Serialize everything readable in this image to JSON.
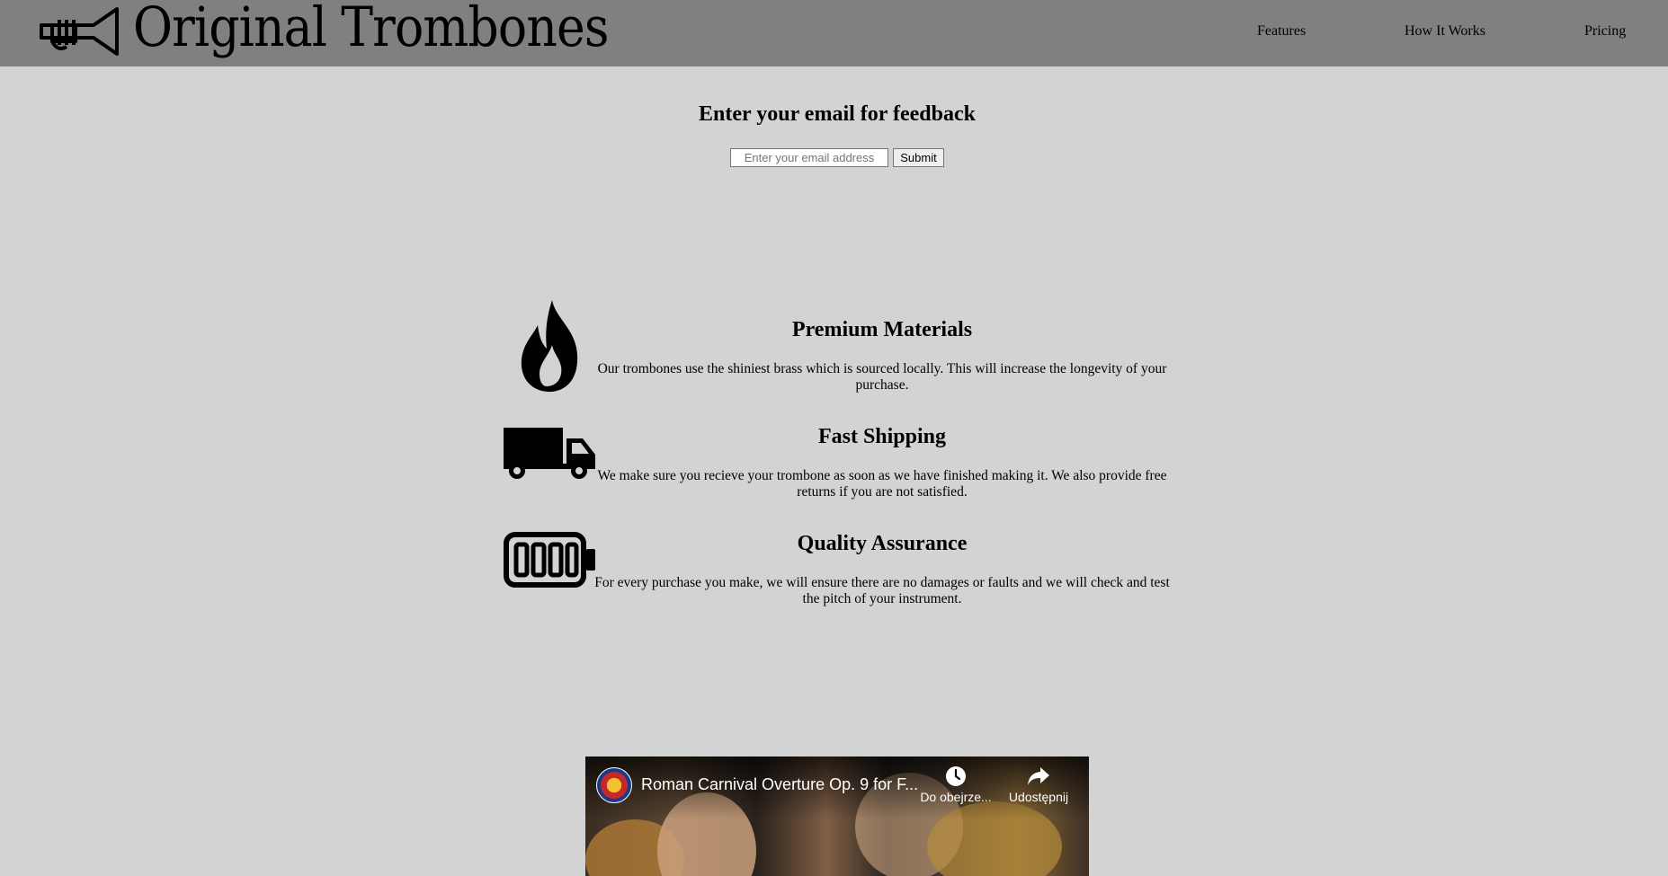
{
  "header": {
    "brand": "Original Trombones",
    "nav": [
      {
        "label": "Features"
      },
      {
        "label": "How It Works"
      },
      {
        "label": "Pricing"
      }
    ]
  },
  "form": {
    "title": "Enter your email for feedback",
    "email_placeholder": "Enter your email address",
    "submit_label": "Submit"
  },
  "features": [
    {
      "icon": "fire-icon",
      "title": "Premium Materials",
      "text": "Our trombones use the shiniest brass which is sourced locally. This will increase the longevity of your purchase."
    },
    {
      "icon": "truck-icon",
      "title": "Fast Shipping",
      "text": "We make sure you recieve your trombone as soon as we have finished making it. We also provide free returns if you are not satisfied."
    },
    {
      "icon": "battery-icon",
      "title": "Quality Assurance",
      "text": "For every purchase you make, we will ensure there are no damages or faults and we will check and test the pitch of your instrument."
    }
  ],
  "video": {
    "title": "Roman Carnival Overture Op. 9 for F...",
    "watch_later_label": "Do obejrze...",
    "share_label": "Udostępnij"
  }
}
